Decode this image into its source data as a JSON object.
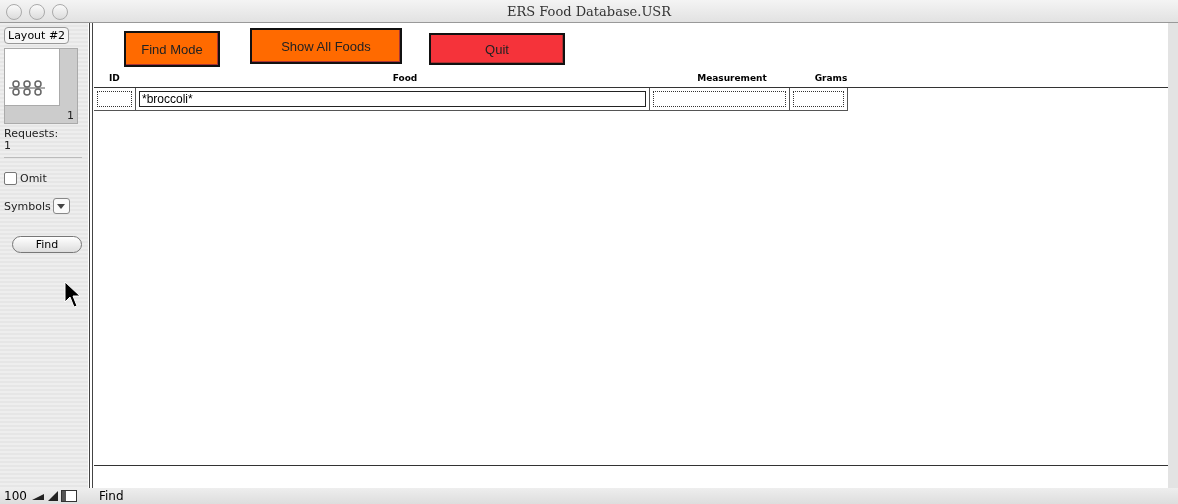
{
  "window": {
    "title": "ERS Food Database.USR"
  },
  "sidebar": {
    "layout": "Layout #2",
    "book_page": "1",
    "requests_label": "Requests:",
    "requests_count": "1",
    "omit": {
      "label": "Omit",
      "checked": false
    },
    "symbols_label": "Symbols",
    "find_button": "Find"
  },
  "buttons": [
    {
      "label": "Find Mode",
      "color": "#ff6a00"
    },
    {
      "label": "Show All Foods",
      "color": "#ff6a00"
    },
    {
      "label": "Quit",
      "color": "#f5333a"
    }
  ],
  "table": {
    "columns": [
      {
        "label": "ID"
      },
      {
        "label": "Food",
        "find_value": "*broccoli*"
      },
      {
        "label": "Measurement"
      },
      {
        "label": "Grams"
      }
    ]
  },
  "status_bar": {
    "zoom": "100",
    "mode": "Find"
  }
}
